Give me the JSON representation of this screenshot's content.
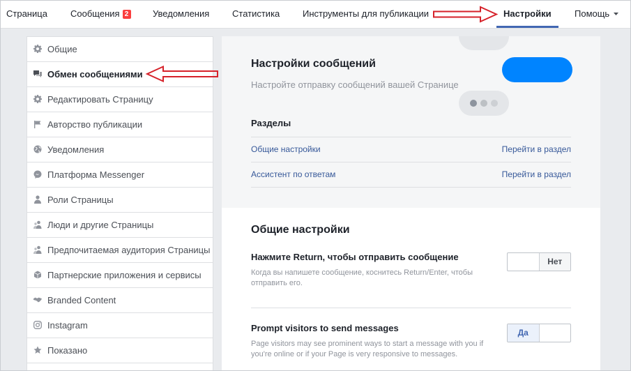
{
  "colors": {
    "accent": "#4267b2",
    "link": "#365899",
    "badge": "#fa3e3e",
    "bubble_blue": "#0084ff",
    "annotation_red": "#d6222a"
  },
  "topnav": {
    "items": [
      {
        "label": "Страница",
        "active": false
      },
      {
        "label": "Сообщения",
        "badge": "2",
        "active": false
      },
      {
        "label": "Уведомления",
        "active": false
      },
      {
        "label": "Статистика",
        "active": false
      },
      {
        "label": "Инструменты для публикации",
        "active": false
      },
      {
        "label": "Настройки",
        "active": true
      },
      {
        "label": "Помощь",
        "active": false,
        "icon": "caret-down-icon"
      }
    ]
  },
  "sidebar": {
    "items": [
      {
        "label": "Общие",
        "icon": "gear-icon",
        "active": false
      },
      {
        "label": "Обмен сообщениями",
        "icon": "chat-icon",
        "active": true
      },
      {
        "label": "Редактировать Страницу",
        "icon": "gear-icon",
        "active": false
      },
      {
        "label": "Авторство публикации",
        "icon": "flag-icon",
        "active": false
      },
      {
        "label": "Уведомления",
        "icon": "globe-icon",
        "active": false
      },
      {
        "label": "Платформа Messenger",
        "icon": "messenger-icon",
        "active": false
      },
      {
        "label": "Роли Страницы",
        "icon": "person-icon",
        "active": false
      },
      {
        "label": "Люди и другие Страницы",
        "icon": "people-icon",
        "active": false
      },
      {
        "label": "Предпочитаемая аудитория Страницы",
        "icon": "people-icon",
        "active": false
      },
      {
        "label": "Партнерские приложения и сервисы",
        "icon": "cube-icon",
        "active": false
      },
      {
        "label": "Branded Content",
        "icon": "handshake-icon",
        "active": false
      },
      {
        "label": "Instagram",
        "icon": "instagram-icon",
        "active": false
      },
      {
        "label": "Показано",
        "icon": "star-icon",
        "active": false
      }
    ]
  },
  "messaging": {
    "title": "Настройки сообщений",
    "subtitle": "Настройте отправку сообщений вашей Странице",
    "sections_heading": "Разделы",
    "sections": [
      {
        "label": "Общие настройки",
        "action": "Перейти в раздел"
      },
      {
        "label": "Ассистент по ответам",
        "action": "Перейти в раздел"
      }
    ]
  },
  "general_settings": {
    "title": "Общие настройки",
    "settings": [
      {
        "title": "Нажмите Return, чтобы отправить сообщение",
        "description": "Когда вы напишете сообщение, коснитесь Return/Enter, чтобы отправить его.",
        "toggle_label": "Нет",
        "enabled": false
      },
      {
        "title": "Prompt visitors to send messages",
        "description": "Page visitors may see prominent ways to start a message with you if you're online or if your Page is very responsive to messages.",
        "toggle_label": "Да",
        "enabled": true
      }
    ]
  }
}
